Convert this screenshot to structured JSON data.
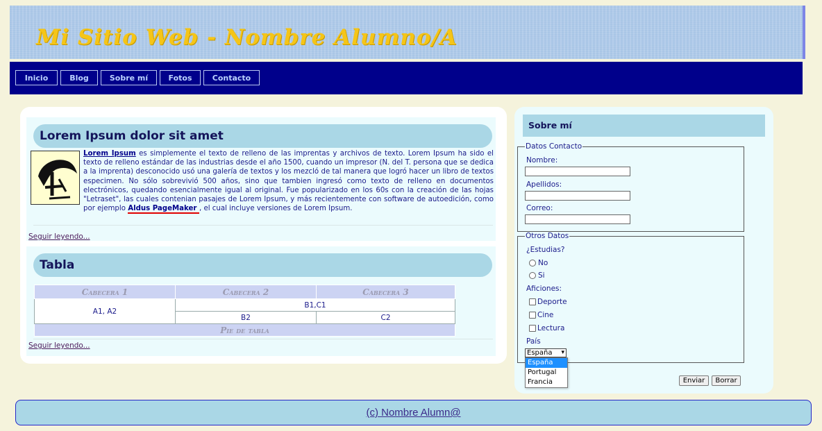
{
  "banner": {
    "title": "Mi Sitio Web - Nombre Alumno/A"
  },
  "nav": {
    "items": [
      "Inicio",
      "Blog",
      "Sobre mí",
      "Fotos",
      "Contacto"
    ]
  },
  "articles": [
    {
      "title": "Lorem Ipsum dolor sit amet",
      "link_strong": "Lorem Ipsum",
      "body_part1": " es simplemente el texto de relleno de las imprentas y archivos de texto. Lorem Ipsum ha sido el texto de relleno estándar de las industrias desde el año 1500, cuando un impresor (N. del T. persona que se dedica a la imprenta) desconocido usó una galería de textos y los mezcló de tal manera que logró hacer un libro de textos especimen. No sólo sobrevivió 500 años, sino que tambien ingresó como texto de relleno en documentos electrónicos, quedando esencialmente igual al original. Fue popularizado en los 60s con la creación de las hojas \"Letraset\", las cuales contenian pasajes de Lorem Ipsum, y más recientemente con software de autoedición, como por ejemplo ",
      "link_pagemaker": "Aldus PageMaker ",
      "body_part2": ", el cual incluye versiones de Lorem Ipsum.",
      "more": "Seguir leyendo..."
    },
    {
      "title": "Tabla",
      "more": "Seguir leyendo..."
    }
  ],
  "table": {
    "headers": [
      "Cabecera 1",
      "Cabecera 2",
      "Cabecera 3"
    ],
    "cell_a": "A1, A2",
    "cell_bc": "B1,C1",
    "cell_b2": "B2",
    "cell_c2": "C2",
    "footer": "Pie de tabla"
  },
  "sidebar": {
    "title": "Sobre mí",
    "contact_legend": "Datos Contacto",
    "name_label": "Nombre:",
    "surname_label": "Apellidos:",
    "email_label": "Correo:",
    "other_legend": "Otros Datos",
    "study_question": "¿Estudias?",
    "radio_no": "No",
    "radio_si": "Si",
    "hobbies_label": "Aficiones:",
    "hobby1": "Deporte",
    "hobby2": "Cine",
    "hobby3": "Lectura",
    "country_label": "País",
    "country_selected": "España",
    "country_options": [
      "España",
      "Portugal",
      "Francia"
    ],
    "send_button": "Enviar",
    "reset_button": "Borrar"
  },
  "footer": {
    "text": "(c) Nombre Alumn@"
  },
  "colors": {
    "navy": "#00008b",
    "accent": "#aad7e6",
    "banner_text": "#f5c518"
  }
}
